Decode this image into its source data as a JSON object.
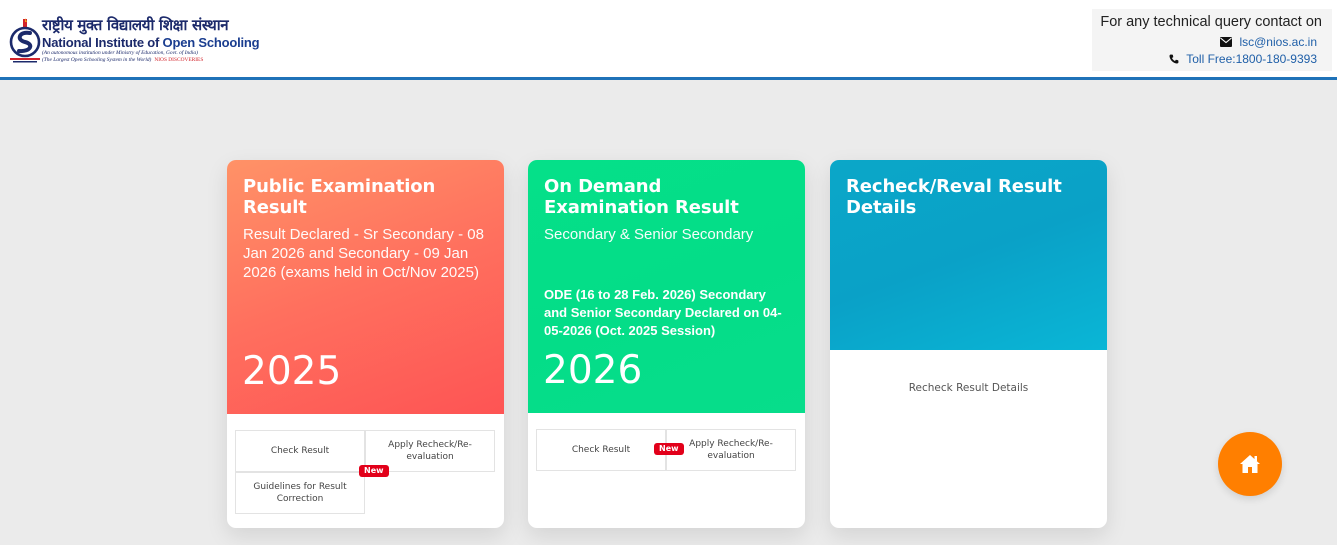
{
  "header": {
    "logo": {
      "icon": "nios-emblem-icon",
      "hindi_name": "राष्ट्रीय मुक्त विद्यालयी शिक्षा संस्थान",
      "english_name_prefix": "National Institute of ",
      "english_name_highlight": "Open Schooling",
      "tagline_1": "(An autonomous institution under Ministry of Education, Govt. of India)",
      "tagline_2": "(The Largest Open Schooling System in the World)",
      "tagline_red": "NIOS DISCOVERIES"
    },
    "contact": {
      "title": "For any technical query contact on",
      "email": "lsc@nios.ac.in",
      "phone": "Toll Free:1800-180-9393",
      "email_icon": "envelope-icon",
      "phone_icon": "phone-icon"
    }
  },
  "cards": [
    {
      "title": "Public Examination Result",
      "subtitle": "Result Declared - Sr Secondary - 08 Jan 2026 and Secondary - 09 Jan 2026 (exams held in Oct/Nov 2025)",
      "year": "2025",
      "links": {
        "check": "Check Result",
        "apply": "Apply Recheck/Re-evaluation",
        "guide": "Guidelines for Result Correction",
        "badge": "New"
      }
    },
    {
      "title": "On Demand Examination Result",
      "subtitle": "Secondary & Senior Secondary",
      "note": "ODE (16 to 28 Feb. 2026) Secondary and Senior Secondary Declared on 04-05-2026 (Oct. 2025 Session)",
      "year": "2026",
      "links": {
        "check": "Check Result",
        "apply": "Apply Recheck/Re-evaluation",
        "badge": "New"
      }
    },
    {
      "title": "Recheck/Reval Result Details",
      "link": "Recheck Result Details"
    }
  ],
  "home_button": {
    "icon": "home-icon"
  },
  "colors": {
    "header_border": "#1f72b8",
    "card1_gradient_start": "#ff9267",
    "card1_gradient_end": "#fe5454",
    "card2": "#05e089",
    "card3": "#0aa8ca",
    "badge": "#e2001a",
    "home_button": "#ff7f00"
  }
}
